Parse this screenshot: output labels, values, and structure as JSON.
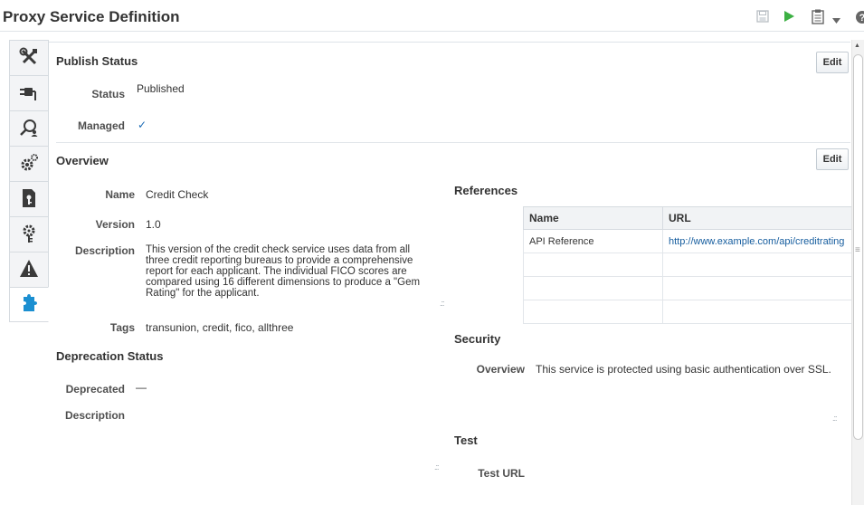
{
  "page": {
    "title": "Proxy Service Definition"
  },
  "toolbar": {
    "save_icon": "save-icon",
    "run_icon": "run-icon",
    "clipboard_icon": "clipboard-icon",
    "dropdown_icon": "chevron-down-icon",
    "help_icon": "help-icon"
  },
  "nav": {
    "items": [
      {
        "icon": "tools-icon"
      },
      {
        "icon": "plug-icon"
      },
      {
        "icon": "search-person-icon"
      },
      {
        "icon": "gears-icon"
      },
      {
        "icon": "document-key-icon"
      },
      {
        "icon": "security-gear-icon"
      },
      {
        "icon": "warning-icon"
      },
      {
        "icon": "puzzle-icon",
        "active": true
      }
    ]
  },
  "publish": {
    "heading": "Publish Status",
    "edit_label": "Edit",
    "status_label": "Status",
    "status_value": "Published",
    "managed_label": "Managed",
    "managed_value": "✓"
  },
  "overview": {
    "heading": "Overview",
    "edit_label": "Edit",
    "name_label": "Name",
    "name_value": "Credit Check",
    "version_label": "Version",
    "version_value": "1.0",
    "description_label": "Description",
    "description_lines": [
      "This version of the credit check service uses data from all",
      "three credit reporting bureaus to provide a comprehensive",
      "report for each applicant. The individual FICO scores are",
      "compared using 16 different dimensions to produce a \"Gem",
      "Rating\" for the applicant."
    ],
    "tags_label": "Tags",
    "tags_value": "transunion, credit, fico, allthree"
  },
  "deprecation": {
    "heading": "Deprecation Status",
    "deprecated_label": "Deprecated",
    "deprecated_value": "—",
    "description_label": "Description"
  },
  "references": {
    "heading": "References",
    "columns": [
      "Name",
      "URL"
    ],
    "rows": [
      {
        "name": "API Reference",
        "url": "http://www.example.com/api/creditrating"
      },
      {
        "name": "",
        "url": ""
      },
      {
        "name": "",
        "url": ""
      },
      {
        "name": "",
        "url": ""
      }
    ]
  },
  "security": {
    "heading": "Security",
    "overview_label": "Overview",
    "overview_value": "This service is protected using basic authentication over SSL."
  },
  "test": {
    "heading": "Test",
    "url_label": "Test URL"
  },
  "colors": {
    "run_green": "#3cb043",
    "link_blue": "#145c9e",
    "nav_icon": "#3a3a3a",
    "active_icon": "#1b8fd1"
  }
}
